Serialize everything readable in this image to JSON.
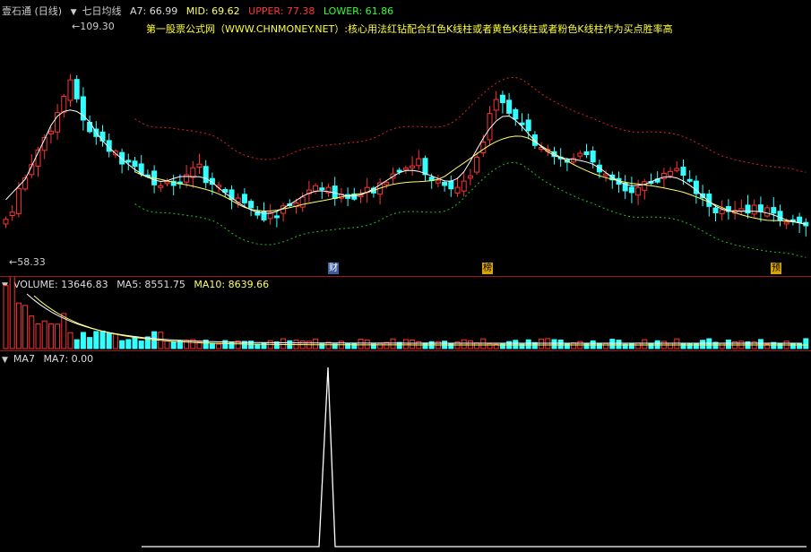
{
  "app": {
    "name": "壹石通 (日线)",
    "indicator": "七日均线"
  },
  "header_main": {
    "a7": "A7: 66.99",
    "mid": "MID: 69.62",
    "upper": "UPPER: 77.38",
    "lower": "LOWER: 61.86"
  },
  "annotation": "第一股票公式网（WWW.CHNMONEY.NET）:核心用法红钻配合红色K线柱或者黄色K线柱或者粉色K线柱作为买点胜率高",
  "price_labels": {
    "high": "109.30",
    "low": "58.33"
  },
  "badges": [
    "财",
    "榜",
    "预"
  ],
  "header_volume": {
    "title": "VOLUME: 13646.83",
    "ma5": "MA5: 8551.75",
    "ma10": "MA10: 8639.66"
  },
  "header_ma7": {
    "title": "MA7",
    "value": "MA7: 0.00"
  },
  "colors": {
    "up": "#ff3333",
    "down": "#33ffff",
    "mid_line": "#ffff66",
    "upper_line": "#e02020",
    "lower_line": "#20c020",
    "a7_line": "#ffffff",
    "volume_ma5": "#ffffff",
    "volume_ma10": "#ffff66"
  }
}
